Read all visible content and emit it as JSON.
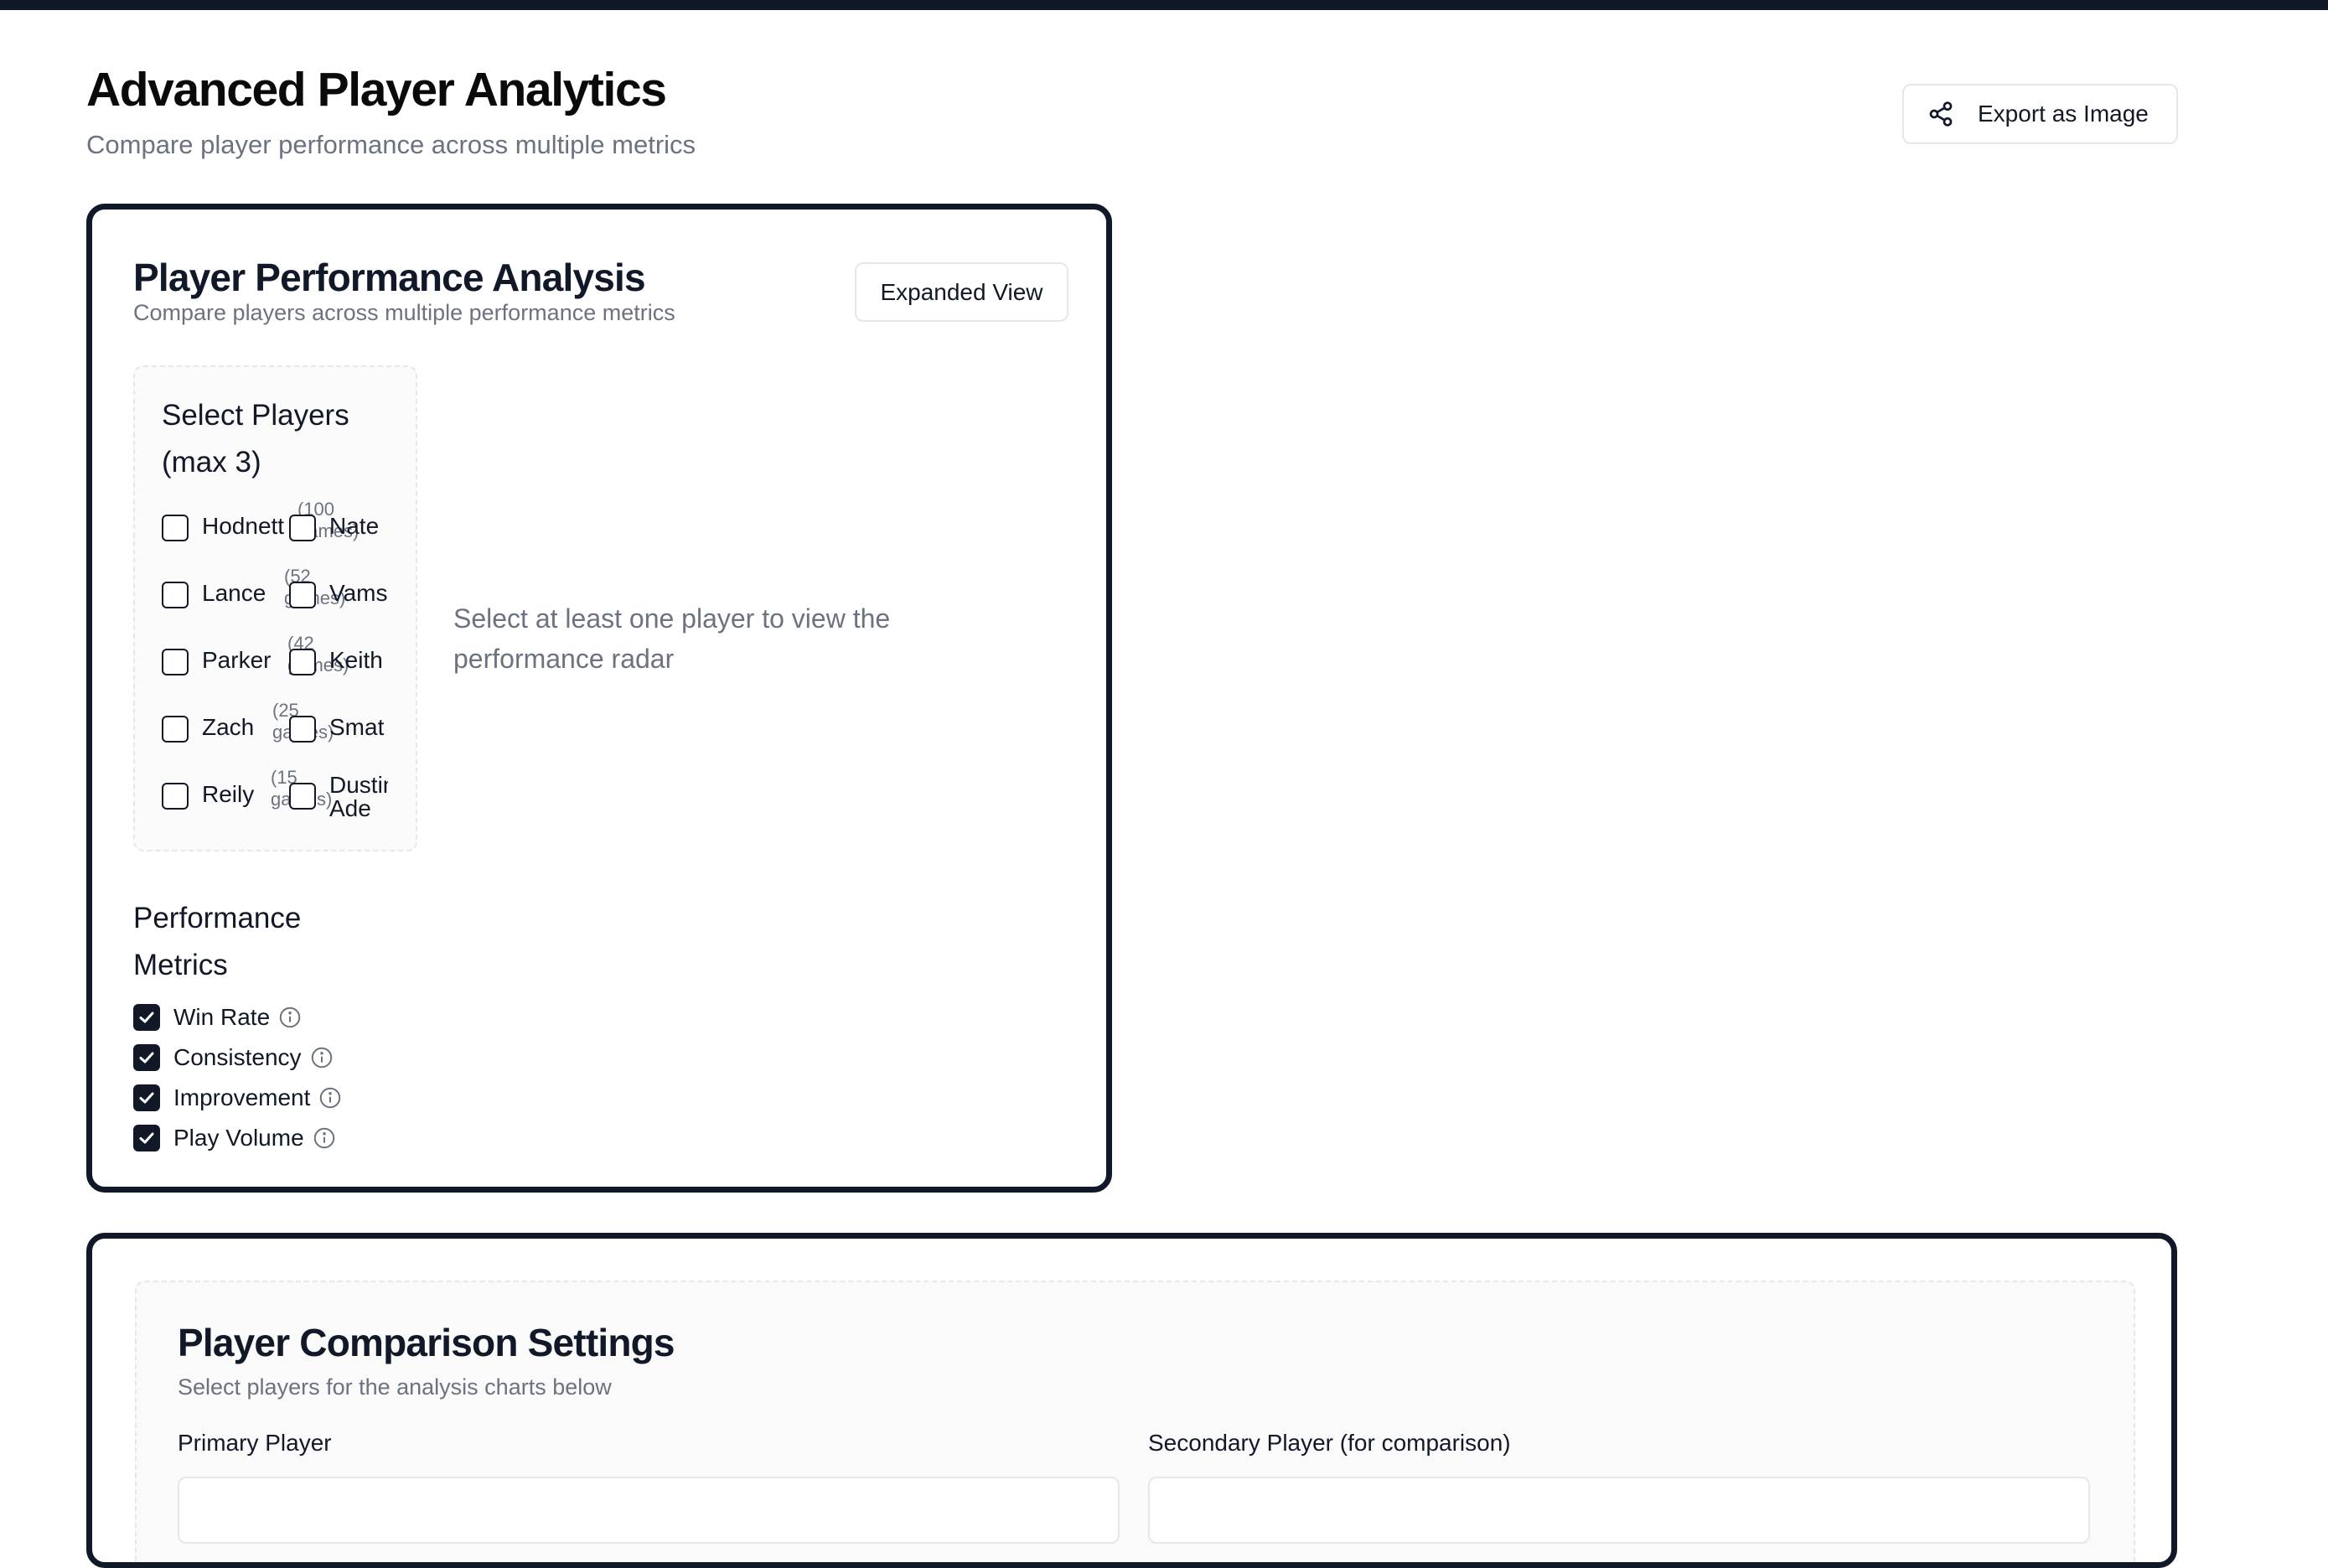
{
  "header": {
    "title": "Advanced Player Analytics",
    "subtitle": "Compare player performance across multiple metrics",
    "export_label": "Export as Image"
  },
  "analysis_card": {
    "title": "Player Performance Analysis",
    "subtitle": "Compare players across multiple performance metrics",
    "expanded_label": "Expanded View",
    "select_title": "Select Players (max 3)",
    "players": [
      {
        "name": "Hodnett",
        "games": "(100 games)"
      },
      {
        "name": "Nate",
        "games": ""
      },
      {
        "name": "Lance",
        "games": "(52 games)"
      },
      {
        "name": "Vams",
        "games": ""
      },
      {
        "name": "Parker",
        "games": "(42 games)"
      },
      {
        "name": "Keith",
        "games": ""
      },
      {
        "name": "Zach",
        "games": "(25 games)"
      },
      {
        "name": "Smat",
        "games": ""
      },
      {
        "name": "Reily",
        "games": "(15 games)"
      },
      {
        "name": "Dustin Ade",
        "games": ""
      }
    ],
    "empty_message": "Select at least one player to view the performance radar",
    "metrics_title": "Performance Metrics",
    "metrics": [
      {
        "label": "Win Rate",
        "checked": true
      },
      {
        "label": "Consistency",
        "checked": true
      },
      {
        "label": "Improvement",
        "checked": true
      },
      {
        "label": "Play Volume",
        "checked": true
      }
    ]
  },
  "comparison_card": {
    "title": "Player Comparison Settings",
    "subtitle": "Select players for the analysis charts below",
    "primary_label": "Primary Player",
    "secondary_label": "Secondary Player (for comparison)"
  }
}
